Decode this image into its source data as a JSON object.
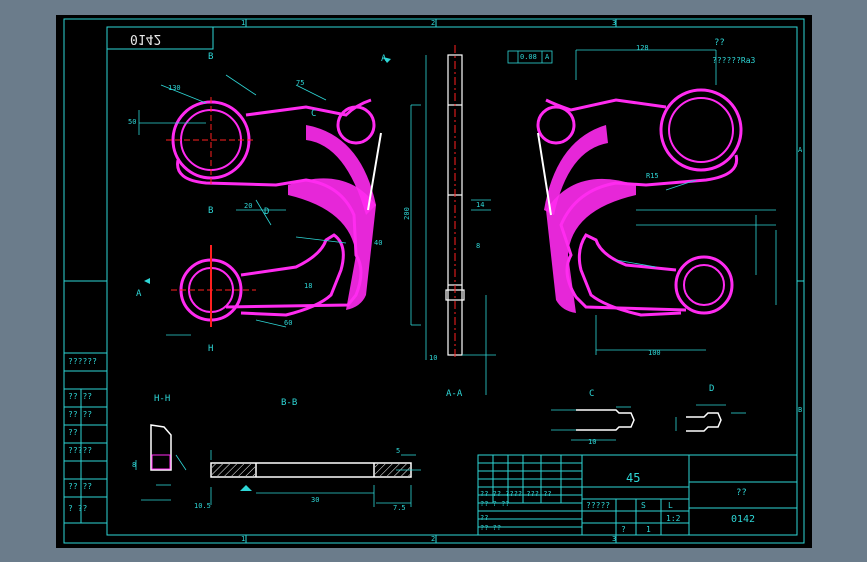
{
  "drawing": {
    "part_number": "0142",
    "part_number_mirrored": "0142",
    "material": "45",
    "scale": "1:2",
    "ratio_left": "1",
    "unknown_title": "??",
    "roughness_note_q": "??",
    "roughness_note": "??????Ra3"
  },
  "views": {
    "hh": "H-H",
    "bb": "B-B",
    "aa": "A-A",
    "c": "C",
    "d": "D"
  },
  "markers": {
    "b_top": "B",
    "b_bottom": "B",
    "h_bottom": "H",
    "a_left": "A",
    "a_top": "A",
    "c_mark": "C",
    "d_mark": "D"
  },
  "border_zones": {
    "top_a": "1",
    "top_b": "2",
    "top_c": "3",
    "right_a": "A",
    "right_b": "B",
    "bottom_a": "1",
    "bottom_b": "2",
    "bottom_c": "3"
  },
  "dims": {
    "d1": "50",
    "d2": "130",
    "d3": "20",
    "d4": "18",
    "d5": "60",
    "d6": "75",
    "d7": "40",
    "d8": "200",
    "d9": "128",
    "d10": "14",
    "d11": "8",
    "d12": "10",
    "d13": "R15",
    "d14": "8",
    "d15": "10.5",
    "d16": "5",
    "d17": "30",
    "d18": "7.5",
    "d19": "10",
    "d20": "100"
  },
  "tolerance": {
    "flatness": "0.08",
    "datum": "A"
  },
  "left_strip": {
    "row1": "??????",
    "row2": "?? ??",
    "row3": "?? ??",
    "row4": "??",
    "row5": "?????",
    "row6": "?? ??",
    "row7": "? ??"
  },
  "title_block": {
    "row_a": "?? ?? ???? ??? ??",
    "row_b": "?? ? ??",
    "row_c": "??",
    "row_d": "?? ??",
    "stage": "?????",
    "weight": "?",
    "col_s": "S",
    "col_l": "L"
  }
}
